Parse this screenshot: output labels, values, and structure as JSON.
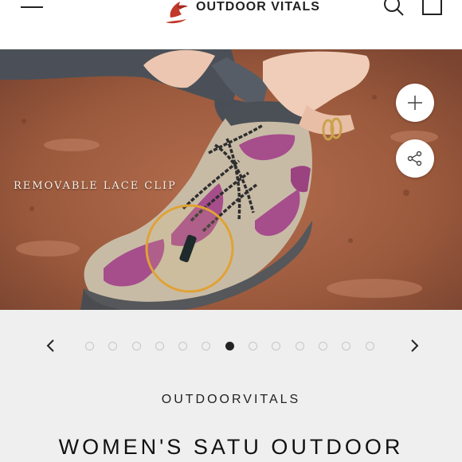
{
  "header": {
    "brand_name": "OUTDOOR VITALS",
    "icons": [
      "menu-icon",
      "logo-bird-icon",
      "search-icon",
      "cart-icon"
    ]
  },
  "hero": {
    "caption": "REMOVABLE LACE CLIP",
    "buttons": [
      "zoom-plus-icon",
      "share-icon"
    ]
  },
  "carousel": {
    "total_slides": 13,
    "active_index": 6
  },
  "product": {
    "vendor": "OUTDOORVITALS",
    "title": "WOMEN'S SATU OUTDOOR"
  },
  "colors": {
    "accent_logo": "#c0392b",
    "highlight_ring": "#e0a236",
    "shoe_purple": "#a64d8c",
    "background_gray": "#efefef"
  }
}
